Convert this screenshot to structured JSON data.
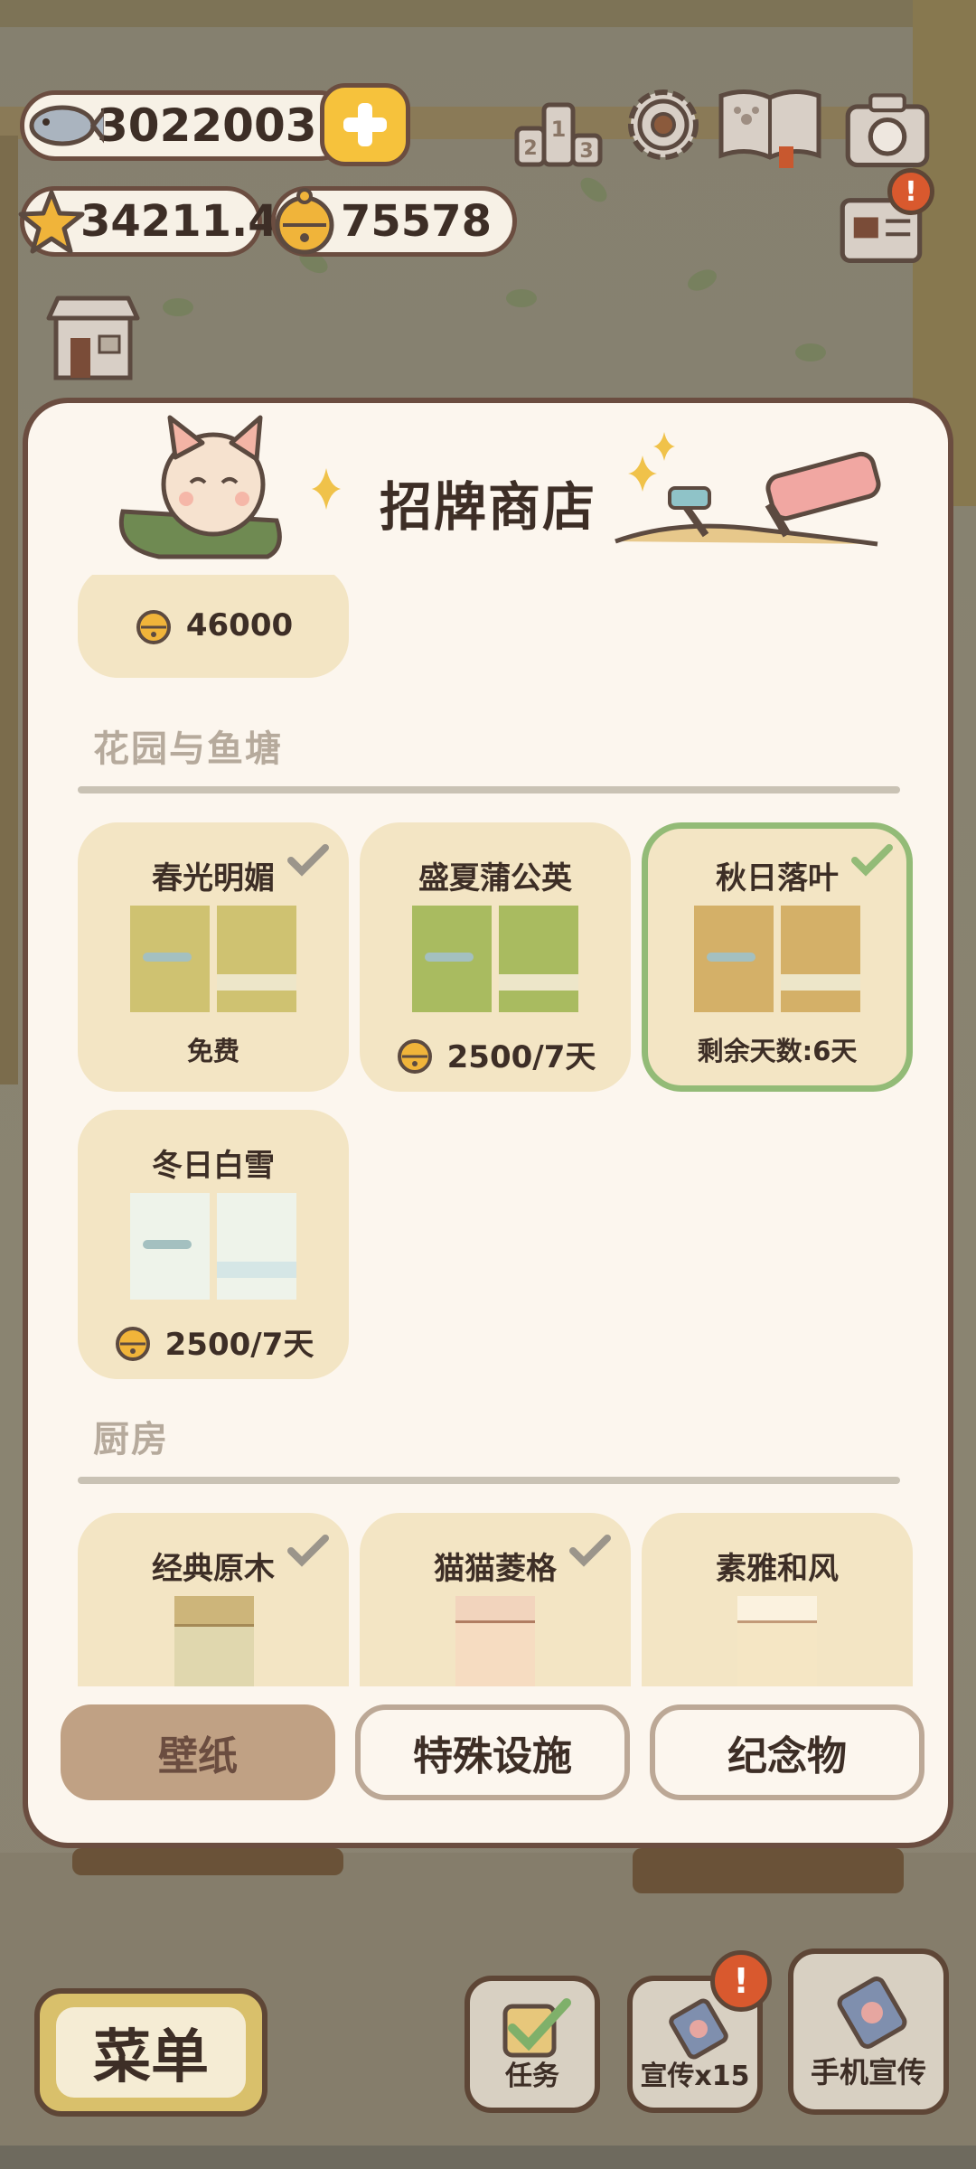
{
  "hud": {
    "fish_count": "3022003",
    "star_count": "34211.4",
    "bell_count": "75578"
  },
  "shop": {
    "title": "招牌商店",
    "top_card_price": "46000",
    "sections": [
      {
        "title": "花园与鱼塘",
        "items": [
          {
            "name": "春光明媚",
            "price": "免费",
            "owned": true,
            "selected": false,
            "colors": [
              "#cfc271",
              "#cfc271"
            ]
          },
          {
            "name": "盛夏蒲公英",
            "price": "2500/7天",
            "owned": false,
            "selected": false,
            "colors": [
              "#a9bb60",
              "#a9bb60"
            ]
          },
          {
            "name": "秋日落叶",
            "price": "剩余天数:6天",
            "owned": true,
            "selected": true,
            "colors": [
              "#d4b068",
              "#d4b068"
            ]
          },
          {
            "name": "冬日白雪",
            "price": "2500/7天",
            "owned": false,
            "selected": false,
            "colors": [
              "#eef3ea",
              "#eef3ea"
            ]
          }
        ]
      },
      {
        "title": "厨房",
        "items": [
          {
            "name": "经典原木",
            "owned": true
          },
          {
            "name": "猫猫菱格",
            "owned": true
          },
          {
            "name": "素雅和风",
            "owned": false
          }
        ]
      }
    ],
    "tabs": [
      "壁纸",
      "特殊设施",
      "纪念物"
    ],
    "active_tab": "壁纸"
  },
  "bottom": {
    "menu_label": "菜单",
    "task_label": "任务",
    "promo_label": "宣传x15",
    "phone_promo_label": "手机宣传"
  },
  "icons": {
    "fish": "fish-icon",
    "star": "star-icon",
    "bell": "bell-icon",
    "plus": "plus-icon",
    "ranking": "ranking-icon",
    "settings": "gear-icon",
    "guide": "guide-book-icon",
    "camera": "camera-icon",
    "mail": "mail-icon",
    "shop": "shop-icon"
  },
  "colors": {
    "panel_bg": "#fcf6ee",
    "card_bg": "#f3e5c4",
    "selected_border": "#93bb77",
    "active_tab": "#c0a184",
    "alert": "#d9592e"
  }
}
